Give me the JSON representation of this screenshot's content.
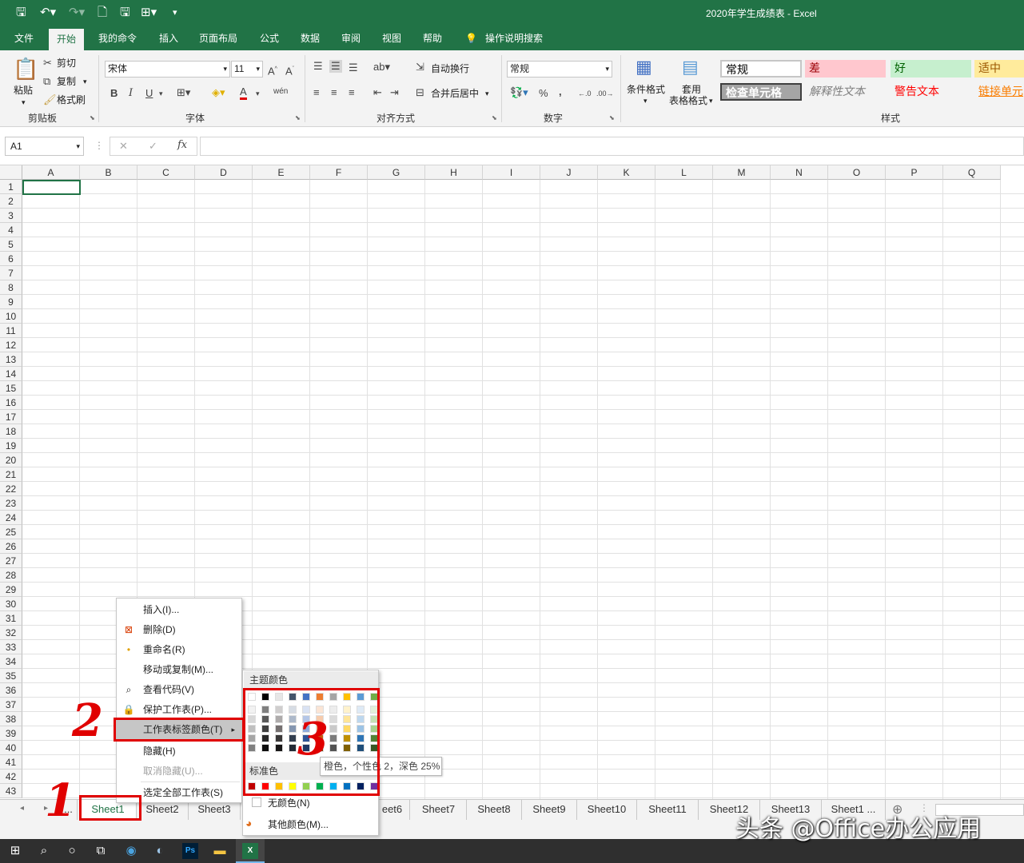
{
  "window": {
    "title": "2020年学生成绩表 - Excel"
  },
  "ribbon_tabs": [
    "文件",
    "开始",
    "我的命令",
    "插入",
    "页面布局",
    "公式",
    "数据",
    "审阅",
    "视图",
    "帮助"
  ],
  "tell_me": "操作说明搜索",
  "clipboard": {
    "paste": "粘贴",
    "cut": "剪切",
    "copy": "复制",
    "format_painter": "格式刷",
    "label": "剪贴板"
  },
  "font": {
    "name": "宋体",
    "size": "11",
    "label": "字体",
    "bold": "B",
    "italic": "I",
    "underline": "U",
    "wen": "wén"
  },
  "alignment": {
    "wrap": "自动换行",
    "merge": "合并后居中",
    "label": "对齐方式"
  },
  "number": {
    "format": "常规",
    "percent": "%",
    "comma": ",",
    "label": "数字"
  },
  "styles": {
    "conditional": "条件格式",
    "table_format_1": "套用",
    "table_format_2": "表格格式",
    "label": "样式",
    "cells": [
      {
        "text": "常规",
        "bg": "#ffffff",
        "color": "#000000"
      },
      {
        "text": "差",
        "bg": "#ffc7ce",
        "color": "#9c0006"
      },
      {
        "text": "好",
        "bg": "#c6efce",
        "color": "#006100"
      },
      {
        "text": "适中",
        "bg": "#ffeb9c",
        "color": "#9c5700"
      },
      {
        "text": "检查单元格",
        "bg": "#a5a5a5",
        "color": "#ffffff"
      },
      {
        "text": "解释性文本",
        "bg": "#f3f3f3",
        "color": "#7f7f7f"
      },
      {
        "text": "警告文本",
        "bg": "#f3f3f3",
        "color": "#ff0000"
      },
      {
        "text": "链接单元",
        "bg": "#f3f3f3",
        "color": "#fa7d00"
      }
    ]
  },
  "formula_bar": {
    "name_box": "A1",
    "fx": "fx",
    "cancel": "✕",
    "enter": "✓",
    "value": ""
  },
  "columns": [
    "A",
    "B",
    "C",
    "D",
    "E",
    "F",
    "G",
    "H",
    "I",
    "J",
    "K",
    "L",
    "M",
    "N",
    "O",
    "P",
    "Q"
  ],
  "rows": [
    "1",
    "2",
    "3",
    "4",
    "5",
    "6",
    "7",
    "8",
    "9",
    "10",
    "11",
    "12",
    "13",
    "14",
    "15",
    "16",
    "17",
    "18",
    "19",
    "20",
    "21",
    "22",
    "23",
    "24",
    "25",
    "26",
    "27",
    "28",
    "29",
    "30",
    "31",
    "32",
    "33",
    "34",
    "35",
    "36",
    "37",
    "38",
    "39",
    "40",
    "41",
    "42",
    "43"
  ],
  "sheet_tabs": [
    "...",
    "Sheet1",
    "Sheet2",
    "Sheet3",
    "eet6",
    "Sheet7",
    "Sheet8",
    "Sheet9",
    "Sheet10",
    "Sheet11",
    "Sheet12",
    "Sheet13",
    "Sheet1 ..."
  ],
  "context_menu": {
    "items": [
      {
        "label": "插入(I)...",
        "icon": "",
        "disabled": false
      },
      {
        "label": "删除(D)",
        "icon": "delete-sheet-icon",
        "disabled": false
      },
      {
        "label": "重命名(R)",
        "icon": "dot-icon",
        "disabled": false
      },
      {
        "label": "移动或复制(M)...",
        "icon": "",
        "disabled": false
      },
      {
        "label": "查看代码(V)",
        "icon": "view-code-icon",
        "disabled": false
      },
      {
        "label": "保护工作表(P)...",
        "icon": "protect-sheet-icon",
        "disabled": false
      },
      {
        "label": "工作表标签颜色(T)",
        "icon": "",
        "disabled": false,
        "submenu": true
      },
      {
        "label": "隐藏(H)",
        "icon": "",
        "disabled": false
      },
      {
        "label": "取消隐藏(U)...",
        "icon": "",
        "disabled": true
      },
      {
        "label": "选定全部工作表(S)",
        "icon": "",
        "disabled": false
      }
    ]
  },
  "color_picker": {
    "theme_header": "主题颜色",
    "standard_header": "标准色",
    "no_color": "无颜色(N)",
    "more_colors": "其他颜色(M)...",
    "theme_top": [
      "#ffffff",
      "#000000",
      "#e7e6e6",
      "#44546a",
      "#4472c4",
      "#ed7d31",
      "#a5a5a5",
      "#ffc000",
      "#5b9bd5",
      "#70ad47"
    ],
    "theme_shades": [
      [
        "#f2f2f2",
        "#7f7f7f",
        "#d0cece",
        "#d6dce4",
        "#d9e2f3",
        "#fbe5d5",
        "#ededed",
        "#fff2cc",
        "#deeaf6",
        "#e2efd9"
      ],
      [
        "#d8d8d8",
        "#595959",
        "#aeabab",
        "#adb9ca",
        "#b4c6e7",
        "#f7cbac",
        "#dbdbdb",
        "#fee599",
        "#bdd7ee",
        "#c5e0b3"
      ],
      [
        "#bfbfbf",
        "#3f3f3f",
        "#757070",
        "#8496b0",
        "#8eaadb",
        "#f4b083",
        "#c9c9c9",
        "#ffd965",
        "#9cc3e5",
        "#a8d08d"
      ],
      [
        "#a5a5a5",
        "#262626",
        "#3a3838",
        "#323e4f",
        "#2f5496",
        "#c55a11",
        "#7b7b7b",
        "#bf8f00",
        "#2e75b5",
        "#538135"
      ],
      [
        "#7f7f7f",
        "#0c0c0c",
        "#171616",
        "#222a35",
        "#1f3864",
        "#833c0b",
        "#525252",
        "#7f6000",
        "#1e4e79",
        "#375623"
      ]
    ],
    "standard": [
      "#c00000",
      "#ff0000",
      "#ffc000",
      "#ffff00",
      "#92d050",
      "#00b050",
      "#00b0f0",
      "#0070c0",
      "#002060",
      "#7030a0"
    ]
  },
  "tooltip": "橙色，个性色 2，深色 25%",
  "annotations": [
    "1",
    "2",
    "3"
  ],
  "watermark": "头条 @Office办公应用"
}
